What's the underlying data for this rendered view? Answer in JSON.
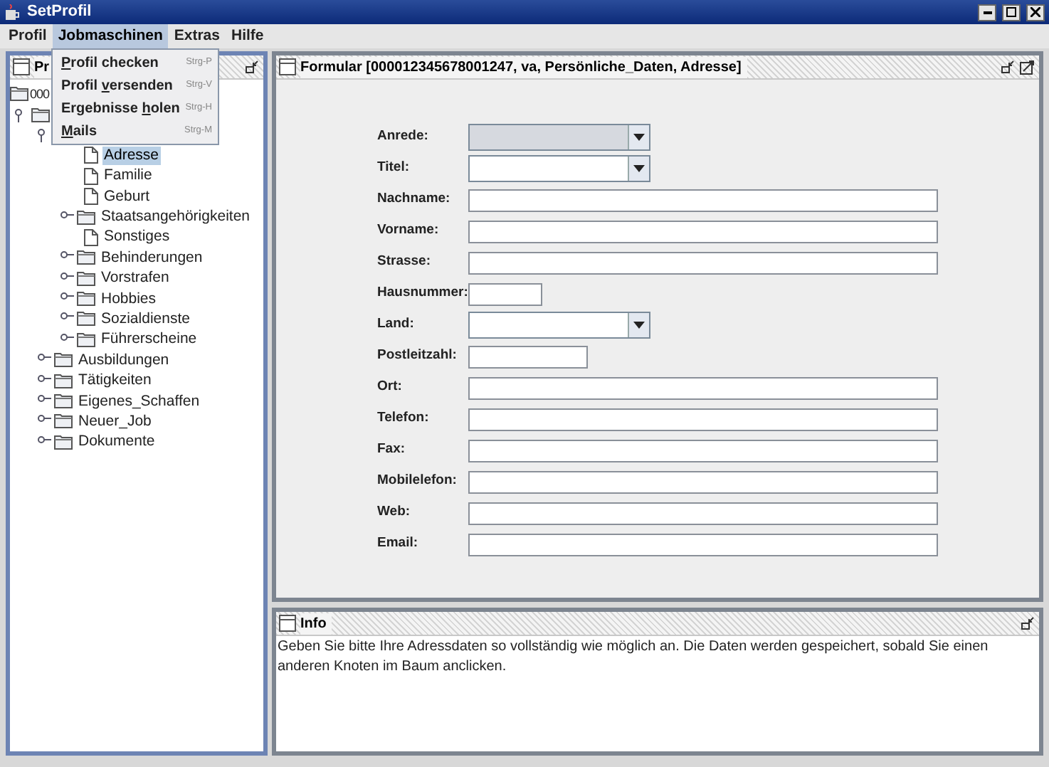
{
  "window": {
    "title": "SetProfil"
  },
  "menubar": [
    {
      "label": "Profil",
      "selected": false
    },
    {
      "label": "Jobmaschinen",
      "selected": true
    },
    {
      "label": "Extras",
      "selected": false
    },
    {
      "label": "Hilfe",
      "selected": false
    }
  ],
  "menu": [
    {
      "label": {
        "key": "P",
        "after": "rofil checken"
      },
      "shortcut": "Strg-P"
    },
    {
      "label": {
        "before": "Profil ",
        "key": "v",
        "after": "ersenden"
      },
      "shortcut": "Strg-V"
    },
    {
      "label": {
        "before": "Ergebnisse ",
        "key": "h",
        "after": "olen"
      },
      "shortcut": "Strg-H"
    },
    {
      "label": {
        "key": "M",
        "after": "ails"
      },
      "shortcut": "Strg-M"
    }
  ],
  "tree_panel": {
    "title": "Pr"
  },
  "tree": {
    "label": "000",
    "kind": "folder",
    "children": [
      {
        "kind": "folder",
        "expanded": true,
        "children": [
          {
            "kind": "folder",
            "expanded": true,
            "children": [
              {
                "label": "Adresse",
                "kind": "file",
                "selected": true
              },
              {
                "label": "Familie",
                "kind": "file",
                "selected": false
              },
              {
                "label": "Geburt",
                "kind": "file",
                "selected": false
              },
              {
                "label": "Staatsangehörigkeiten",
                "kind": "folder",
                "expanded": false,
                "selected": false
              },
              {
                "label": "Sonstiges",
                "kind": "file",
                "selected": false
              },
              {
                "label": "Behinderungen",
                "kind": "folder",
                "expanded": false,
                "selected": false
              },
              {
                "label": "Vorstrafen",
                "kind": "folder",
                "expanded": false,
                "selected": false
              },
              {
                "label": "Hobbies",
                "kind": "folder",
                "expanded": false,
                "selected": false
              },
              {
                "label": "Sozialdienste",
                "kind": "folder",
                "expanded": false,
                "selected": false
              },
              {
                "label": "Führerscheine",
                "kind": "folder",
                "expanded": false,
                "selected": false
              }
            ]
          },
          {
            "label": "Ausbildungen",
            "kind": "folder",
            "expanded": false,
            "selected": false
          },
          {
            "label": "Tätigkeiten",
            "kind": "folder",
            "expanded": false,
            "selected": false
          },
          {
            "label": "Eigenes_Schaffen",
            "kind": "folder",
            "expanded": false,
            "selected": false
          },
          {
            "label": "Neuer_Job",
            "kind": "folder",
            "expanded": false,
            "selected": false
          },
          {
            "label": "Dokumente",
            "kind": "folder",
            "expanded": false,
            "selected": false
          }
        ]
      }
    ]
  },
  "form_panel": {
    "title": "Formular [000012345678001247, va, Persönliche_Daten, Adresse]",
    "fields": [
      {
        "label": "Anrede:",
        "kind": "combo",
        "disabled": true
      },
      {
        "label": "Titel:",
        "kind": "combo",
        "disabled": false
      },
      {
        "label": "Nachname:",
        "kind": "text",
        "disabled": false
      },
      {
        "label": "Vorname:",
        "kind": "text",
        "disabled": false
      },
      {
        "label": "Strasse:",
        "kind": "text",
        "disabled": false
      },
      {
        "label": "Hausnummer:",
        "kind": "short_text",
        "disabled": false
      },
      {
        "label": "Land:",
        "kind": "combo",
        "disabled": false
      },
      {
        "label": "Postleitzahl:",
        "kind": "medium_text",
        "disabled": false
      },
      {
        "label": "Ort:",
        "kind": "text",
        "disabled": false
      },
      {
        "label": "Telefon:",
        "kind": "text",
        "disabled": false
      },
      {
        "label": "Fax:",
        "kind": "text",
        "disabled": false
      },
      {
        "label": "Mobilelefon:",
        "kind": "text",
        "disabled": false
      },
      {
        "label": "Web:",
        "kind": "text",
        "disabled": false
      },
      {
        "label": "Email:",
        "kind": "text",
        "disabled": false
      }
    ]
  },
  "info_panel": {
    "title": "Info",
    "text": "Geben Sie bitte Ihre Adressdaten so vollständig wie möglich an. Die Daten werden gespeichert, sobald Sie einen anderen Knoten im Baum anclicken."
  }
}
